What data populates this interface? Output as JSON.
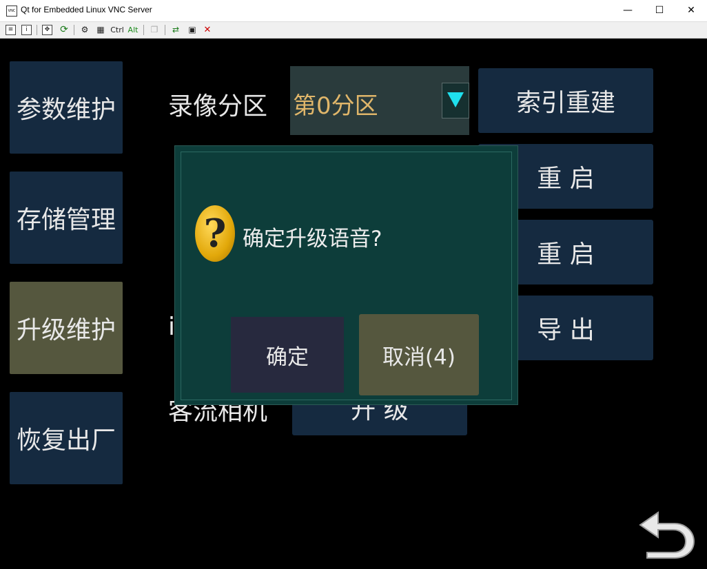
{
  "window": {
    "title": "Qt for Embedded Linux VNC Server",
    "icon_text": "VNC",
    "minimize": "—",
    "maximize": "☐",
    "close": "✕"
  },
  "toolbar": {
    "ctrl_label": "Ctrl",
    "alt_label": "Alt",
    "icons": [
      "options-icon",
      "info-icon",
      "fullscreen-icon",
      "refresh-icon",
      "ctrl-alt-del-icon",
      "start-icon",
      "copy-icon",
      "transfer-icon",
      "save-icon",
      "disconnect-icon"
    ]
  },
  "sidebar": {
    "items": [
      {
        "label": "参数维护",
        "active": false
      },
      {
        "label": "存储管理",
        "active": false
      },
      {
        "label": "升级维护",
        "active": true
      },
      {
        "label": "恢复出厂",
        "active": false
      }
    ]
  },
  "main": {
    "partition_label": "录像分区",
    "partition_value": "第0分区",
    "rebuild_index": "索引重建",
    "restart_1": "重 启",
    "restart_2": "重 启",
    "export": "导 出",
    "hidden_label_fragment": "i",
    "passenger_label": "客流相机",
    "upgrade_button": "升 级"
  },
  "dialog": {
    "message": "确定升级语音?",
    "confirm": "确定",
    "cancel": "取消(4)"
  },
  "colors": {
    "sidebar_bg": "#152a40",
    "sidebar_active": "#55573e",
    "dialog_bg": "#0d3d3a",
    "accent_text": "#e0b66a",
    "arrow": "#1fe0ee"
  }
}
